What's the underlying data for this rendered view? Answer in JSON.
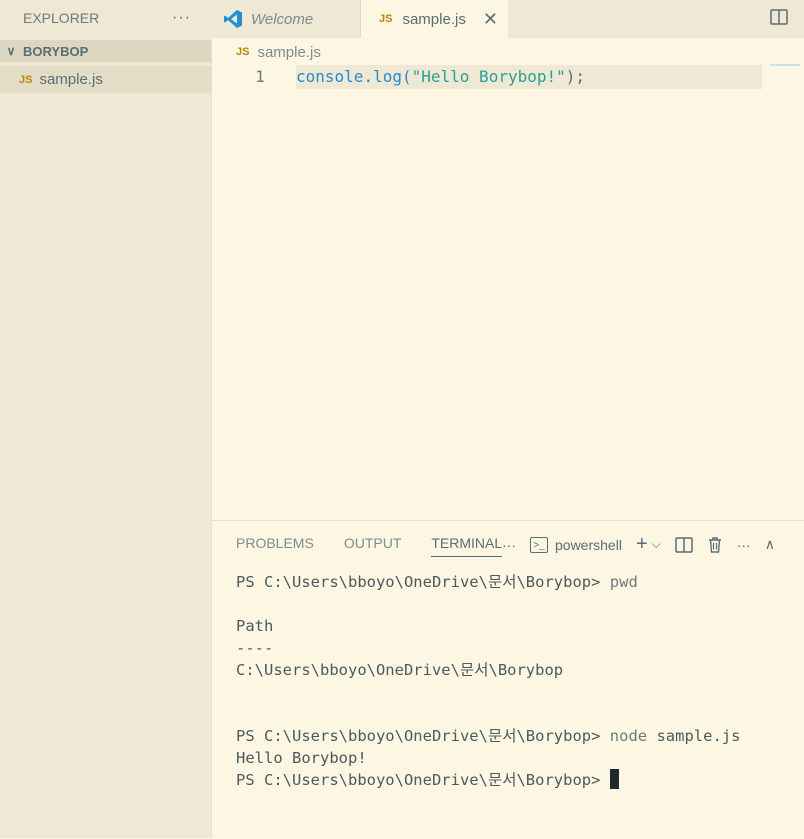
{
  "sidebar": {
    "title": "EXPLORER",
    "more": "···",
    "folder": {
      "chevron": "∨",
      "name": "BORYBOP"
    },
    "file": {
      "icon": "JS",
      "name": "sample.js"
    }
  },
  "tabs": [
    {
      "icon": "vscode-icon",
      "label": "Welcome"
    },
    {
      "icon": "JS",
      "label": "sample.js",
      "close": "✕"
    }
  ],
  "editor": {
    "breadcrumb": {
      "icon": "JS",
      "label": "sample.js"
    },
    "line_number": "1",
    "code": {
      "obj": "console",
      "dot": ".",
      "fn": "log",
      "open": "(",
      "str": "\"Hello Borybop!\"",
      "close": ");"
    }
  },
  "panel": {
    "tabs": [
      "PROBLEMS",
      "OUTPUT",
      "TERMINAL"
    ],
    "more": "···",
    "shell": "powershell",
    "add": "+",
    "dropdown": "⌵",
    "more2": "···",
    "collapse": "∧"
  },
  "terminal": {
    "lines": [
      {
        "prompt": "PS C:\\Users\\bboyo\\OneDrive\\문서\\Borybop> ",
        "cmd": "pwd"
      },
      {
        "text": ""
      },
      {
        "text": "Path"
      },
      {
        "text": "----"
      },
      {
        "text": "C:\\Users\\bboyo\\OneDrive\\문서\\Borybop"
      },
      {
        "text": ""
      },
      {
        "text": ""
      },
      {
        "prompt": "PS C:\\Users\\bboyo\\OneDrive\\문서\\Borybop> ",
        "cmd": "node",
        "arg": " sample.js"
      },
      {
        "text": "Hello Borybop!"
      },
      {
        "prompt": "PS C:\\Users\\bboyo\\OneDrive\\문서\\Borybop> "
      }
    ]
  }
}
